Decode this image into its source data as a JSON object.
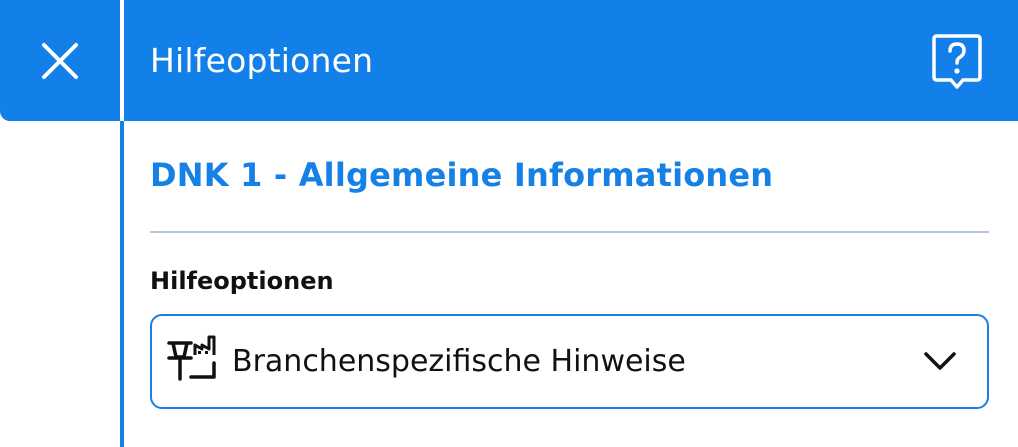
{
  "header": {
    "title": "Hilfeoptionen",
    "close_icon": "close-icon",
    "help_icon": "help-question-bubble-icon",
    "background_color": "#1380ea"
  },
  "section": {
    "title": "DNK 1 - Allgemeine Informationen",
    "title_color": "#1580e6"
  },
  "help_options": {
    "label": "Hilfeoptionen",
    "selected_value": "Branchenspezifische Hinweise",
    "selected_icon": "industry-pin-icon",
    "dropdown_icon": "chevron-down-icon"
  }
}
